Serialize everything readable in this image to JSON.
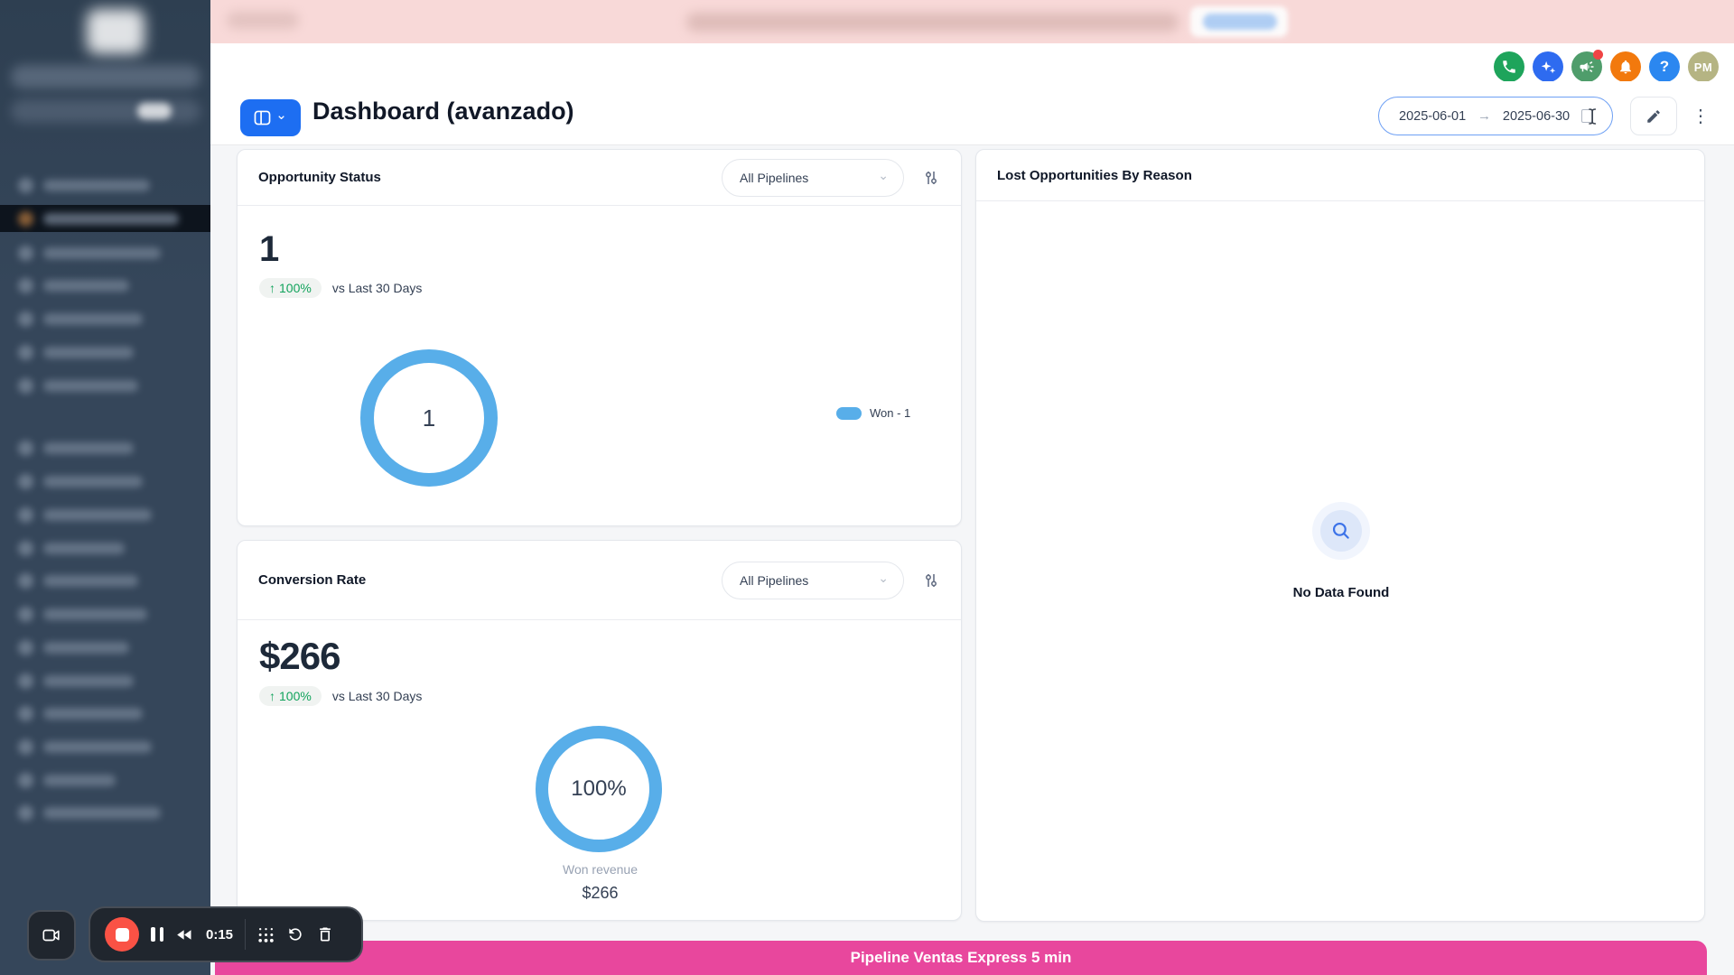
{
  "ui": {
    "trend_arrow": "↑",
    "chevron": "⌄",
    "kebab": "⋮",
    "date_arrow": "→"
  },
  "topbar": {
    "avatar_initials": "PM",
    "help_glyph": "?"
  },
  "header": {
    "title": "Dashboard (avanzado)",
    "date_start": "2025-06-01",
    "date_end": "2025-06-30"
  },
  "cards": {
    "opportunity_status": {
      "title": "Opportunity Status",
      "filter_value": "All Pipelines",
      "stat_value": "1",
      "change_pct": "100%",
      "change_caption": "vs Last 30 Days",
      "donut_center": "1",
      "legend_label": "Won - 1"
    },
    "conversion_rate": {
      "title": "Conversion Rate",
      "filter_value": "All Pipelines",
      "stat_value": "$266",
      "change_pct": "100%",
      "change_caption": "vs Last 30 Days",
      "donut_center": "100%",
      "donut_caption": "Won revenue",
      "donut_caption_value": "$266"
    },
    "lost_opportunities": {
      "title": "Lost Opportunities By Reason",
      "empty_state": "No Data Found"
    }
  },
  "footer_bar": {
    "label": "Pipeline Ventas Express 5 min"
  },
  "recorder": {
    "timer": "0:15"
  },
  "colors": {
    "accent_blue": "#1d6ef2",
    "donut_blue": "#58aee9",
    "badge_green": "#12a35c",
    "footer_pink": "#e8479d",
    "banner_pink": "#f8d9d8",
    "sidebar_navy": "#35465a",
    "record_red": "#fa5245"
  },
  "chart_data": [
    {
      "type": "pie",
      "title": "Opportunity Status",
      "series": [
        {
          "name": "Won",
          "value": 1
        }
      ],
      "center_label": "1",
      "legend": [
        "Won - 1"
      ],
      "color": "#58aee9",
      "legend_position": "right"
    },
    {
      "type": "pie",
      "title": "Conversion Rate",
      "series": [
        {
          "name": "Won revenue",
          "value": 100
        }
      ],
      "center_label": "100%",
      "caption": "Won revenue",
      "caption_value": "$266",
      "color": "#58aee9"
    }
  ]
}
